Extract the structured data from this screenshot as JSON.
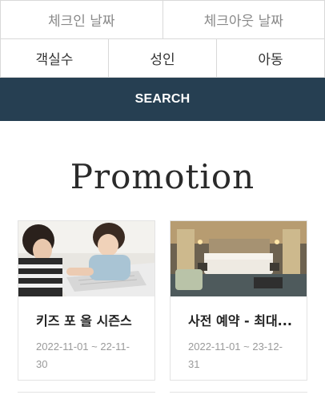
{
  "booking": {
    "checkin": "체크인 날짜",
    "checkout": "체크아웃 날짜",
    "rooms": "객실수",
    "adults": "성인",
    "children": "아동",
    "search": "SEARCH"
  },
  "promotion": {
    "title": "Promotion",
    "cards": [
      {
        "title": "키즈 포 올 시즌스",
        "date": "2022-11-01 ~ 22-11-30"
      },
      {
        "title": "사전 예약 - 최대...",
        "date": "2022-11-01 ~ 23-12-31"
      }
    ]
  },
  "colors": {
    "search_bg": "#263f52"
  }
}
